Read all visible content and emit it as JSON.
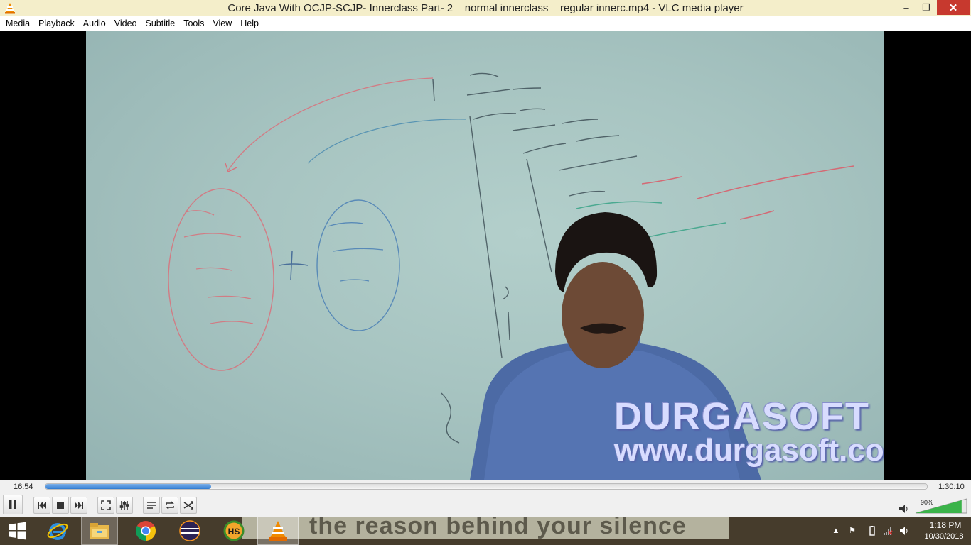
{
  "window": {
    "title": "Core Java With OCJP-SCJP- Innerclass  Part- 2__normal innerclass__regular innerc.mp4 - VLC media player",
    "app_icon": "vlc-cone-icon",
    "minimize_icon": "minimize-icon",
    "maximize_icon": "restore-icon",
    "close_icon": "close-icon"
  },
  "menu": {
    "items": [
      "Media",
      "Playback",
      "Audio",
      "Video",
      "Subtitle",
      "Tools",
      "View",
      "Help"
    ]
  },
  "video": {
    "watermark_line1": "DURGASOFT",
    "watermark_line2": "www.durgasoft.com"
  },
  "playback": {
    "elapsed": "16:54",
    "total": "1:30:10",
    "progress_fraction": 0.1875
  },
  "controls": {
    "buttons": [
      "pause-icon",
      "previous-icon",
      "stop-icon",
      "next-icon",
      "fullscreen-icon",
      "extended-settings-icon",
      "playlist-icon",
      "loop-icon",
      "shuffle-icon"
    ],
    "volume_percent": "90%",
    "volume_level": 0.9
  },
  "taskbar": {
    "background_banner": "the reason behind your silence",
    "apps": [
      "windows-start-icon",
      "internet-explorer-icon",
      "file-explorer-icon",
      "chrome-icon",
      "eclipse-icon",
      "hs-app-icon",
      "vlc-icon"
    ],
    "tray": [
      "show-hidden-icons-icon",
      "action-center-flag-icon",
      "battery-icon",
      "network-icon",
      "speaker-icon"
    ],
    "clock_time": "1:18 PM",
    "clock_date": "10/30/2018"
  },
  "colors": {
    "title_bar": "#f4eeca",
    "seek_fill": "#2f7bd1",
    "close_button": "#c7392e",
    "volume_fill": "#3bb34a"
  }
}
